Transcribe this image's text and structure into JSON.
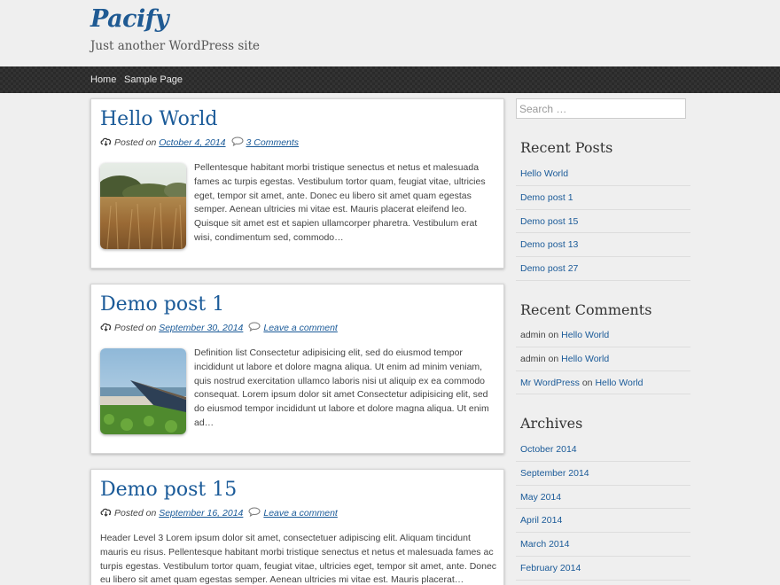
{
  "site": {
    "title": "Pacify",
    "description": "Just another WordPress site"
  },
  "nav": {
    "items": [
      {
        "label": "Home"
      },
      {
        "label": "Sample Page"
      }
    ]
  },
  "posts": [
    {
      "title": "Hello World",
      "posted_on": "Posted on",
      "date": "October 4, 2014",
      "comments": "3 Comments",
      "excerpt": "Pellentesque habitant morbi tristique senectus et netus et malesuada fames ac turpis egestas. Vestibulum tortor quam, feugiat vitae, ultricies eget, tempor sit amet, ante. Donec eu libero sit amet quam egestas semper. Aenean ultricies mi vitae est. Mauris placerat eleifend leo. Quisque sit amet est et sapien ullamcorper pharetra. Vestibulum erat wisi, condimentum sed, commodo…"
    },
    {
      "title": "Demo post 1",
      "posted_on": "Posted on",
      "date": "September 30, 2014",
      "comments": "Leave a comment",
      "excerpt": "Definition list Consectetur adipisicing elit, sed do eiusmod tempor incididunt ut labore et dolore magna aliqua. Ut enim ad minim veniam, quis nostrud exercitation ullamco laboris nisi ut aliquip ex ea commodo consequat. Lorem ipsum dolor sit amet Consectetur adipisicing elit, sed do eiusmod tempor incididunt ut labore et dolore magna aliqua. Ut enim ad…"
    },
    {
      "title": "Demo post 15",
      "posted_on": "Posted on",
      "date": "September 16, 2014",
      "comments": "Leave a comment",
      "excerpt": "Header Level 3 Lorem ipsum dolor sit amet, consectetuer adipiscing elit. Aliquam tincidunt mauris eu risus. Pellentesque habitant morbi tristique senectus et netus et malesuada fames ac turpis egestas. Vestibulum tortor quam, feugiat vitae, ultricies eget, tempor sit amet, ante. Donec eu libero sit amet quam egestas semper. Aenean ultricies mi vitae est. Mauris placerat…"
    }
  ],
  "sidebar": {
    "search_placeholder": "Search …",
    "recent_posts": {
      "title": "Recent Posts",
      "items": [
        "Hello World",
        "Demo post 1",
        "Demo post 15",
        "Demo post 13",
        "Demo post 27"
      ]
    },
    "recent_comments": {
      "title": "Recent Comments",
      "items": [
        {
          "author": "admin",
          "on": "on",
          "post": "Hello World"
        },
        {
          "author": "admin",
          "on": "on",
          "post": "Hello World"
        },
        {
          "author": "Mr WordPress",
          "on": "on",
          "post": "Hello World"
        }
      ]
    },
    "archives": {
      "title": "Archives",
      "items": [
        "October 2014",
        "September 2014",
        "May 2014",
        "April 2014",
        "March 2014",
        "February 2014"
      ]
    }
  },
  "colors": {
    "link": "#1a5a98",
    "title": "#1f5a93",
    "nav_bg": "#2a2a2a"
  }
}
